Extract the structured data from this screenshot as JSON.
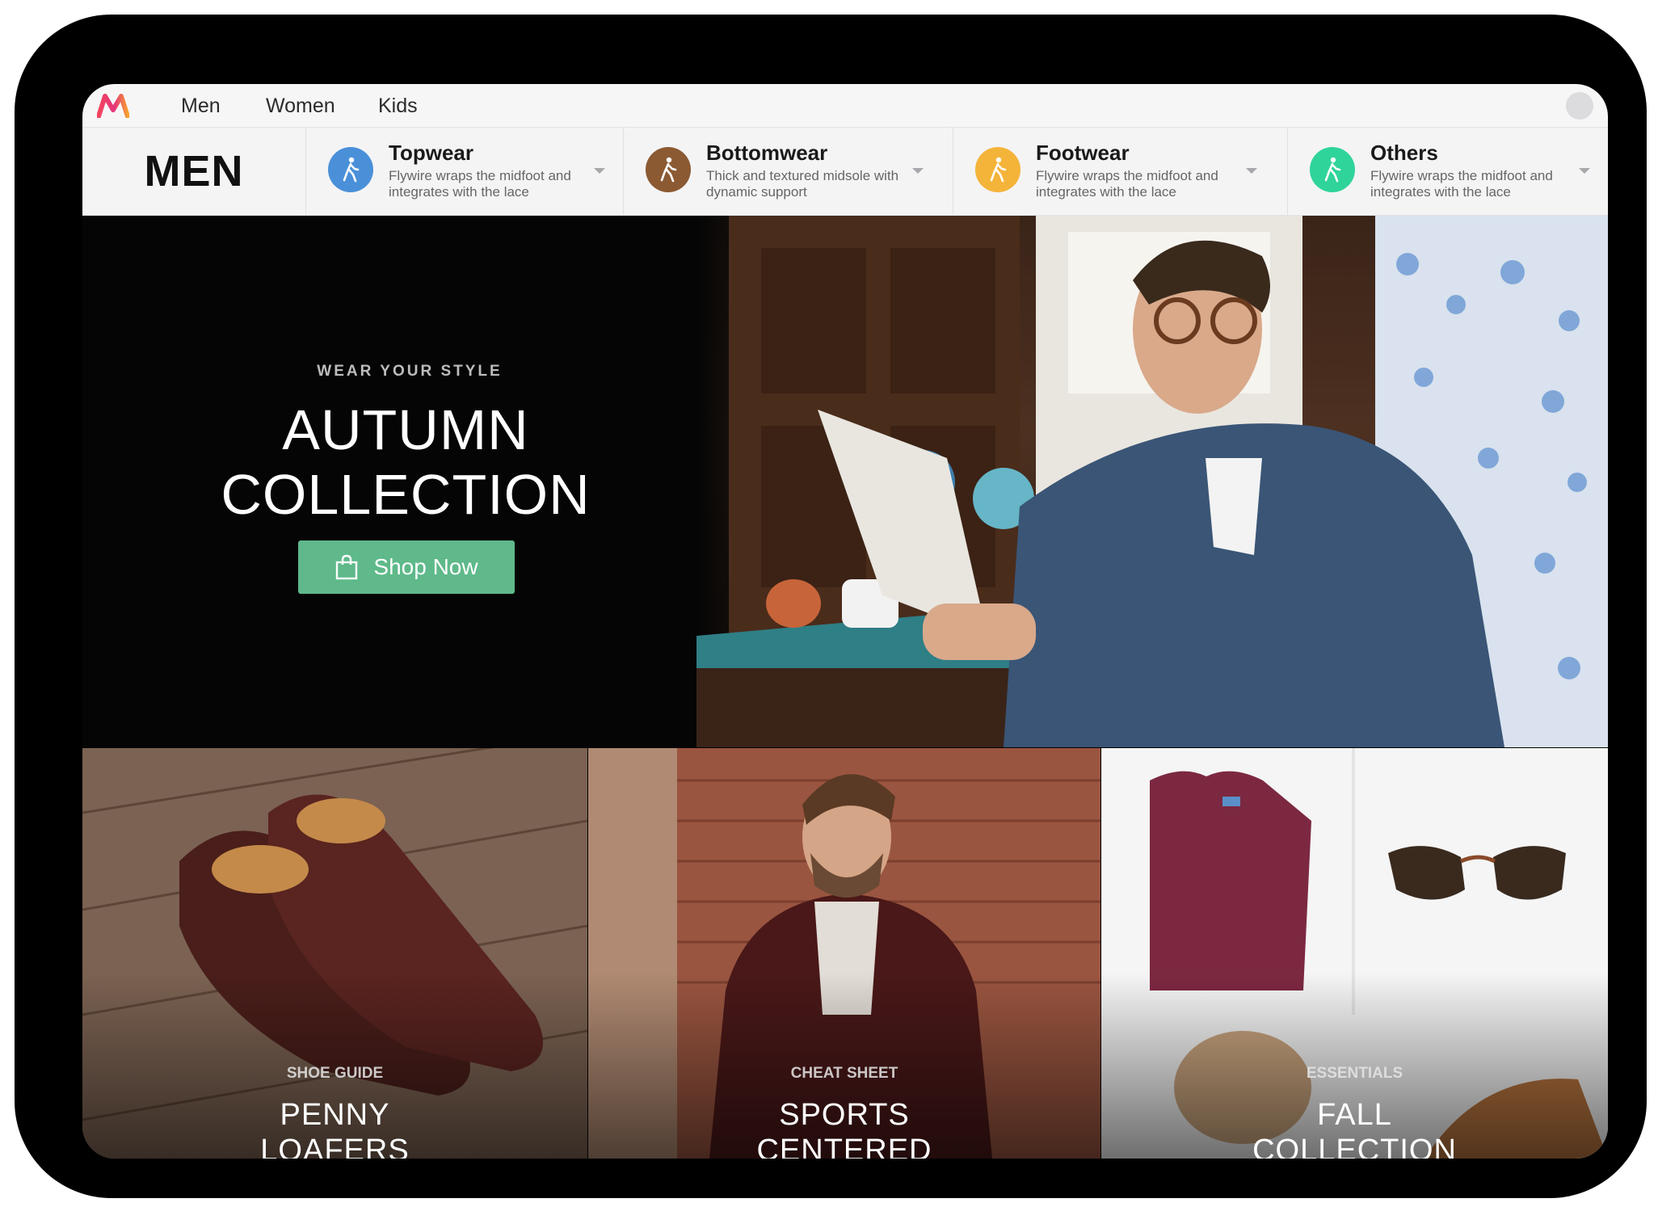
{
  "app": {
    "accent_colors": {
      "topwear": "#4a90d9",
      "bottomwear": "#8b5a33",
      "footwear": "#f4b43a",
      "others": "#2fd49a",
      "shop_button": "#5fb98a"
    }
  },
  "topnav": {
    "links": [
      "Men",
      "Women",
      "Kids"
    ]
  },
  "section_title": "MEN",
  "categories": [
    {
      "title": "Topwear",
      "desc_line1": "Flywire wraps the midfoot and",
      "desc_line2": "integrates with the lace",
      "icon": "walking-person-icon"
    },
    {
      "title": "Bottomwear",
      "desc_line1": "Thick and textured midsole with",
      "desc_line2": "dynamic support",
      "icon": "walking-person-icon"
    },
    {
      "title": "Footwear",
      "desc_line1": "Flywire wraps the midfoot and",
      "desc_line2": "integrates with the lace",
      "icon": "walking-person-icon"
    },
    {
      "title": "Others",
      "desc_line1": "Flywire wraps the midfoot and",
      "desc_line2": "integrates with the lace",
      "icon": "walking-person-icon"
    }
  ],
  "hero": {
    "overline": "WEAR YOUR STYLE",
    "title_line1": "AUTUMN",
    "title_line2": "COLLECTION",
    "button_label": "Shop Now",
    "button_icon": "shopping-bag-icon"
  },
  "tiles": [
    {
      "overline": "SHOE GUIDE",
      "title_line1": "PENNY",
      "title_line2": "LOAFERS"
    },
    {
      "overline": "CHEAT SHEET",
      "title_line1": "SPORTS",
      "title_line2": "CENTERED"
    },
    {
      "overline": "ESSENTIALS",
      "title_line1": "FALL",
      "title_line2": "COLLECTION"
    }
  ]
}
